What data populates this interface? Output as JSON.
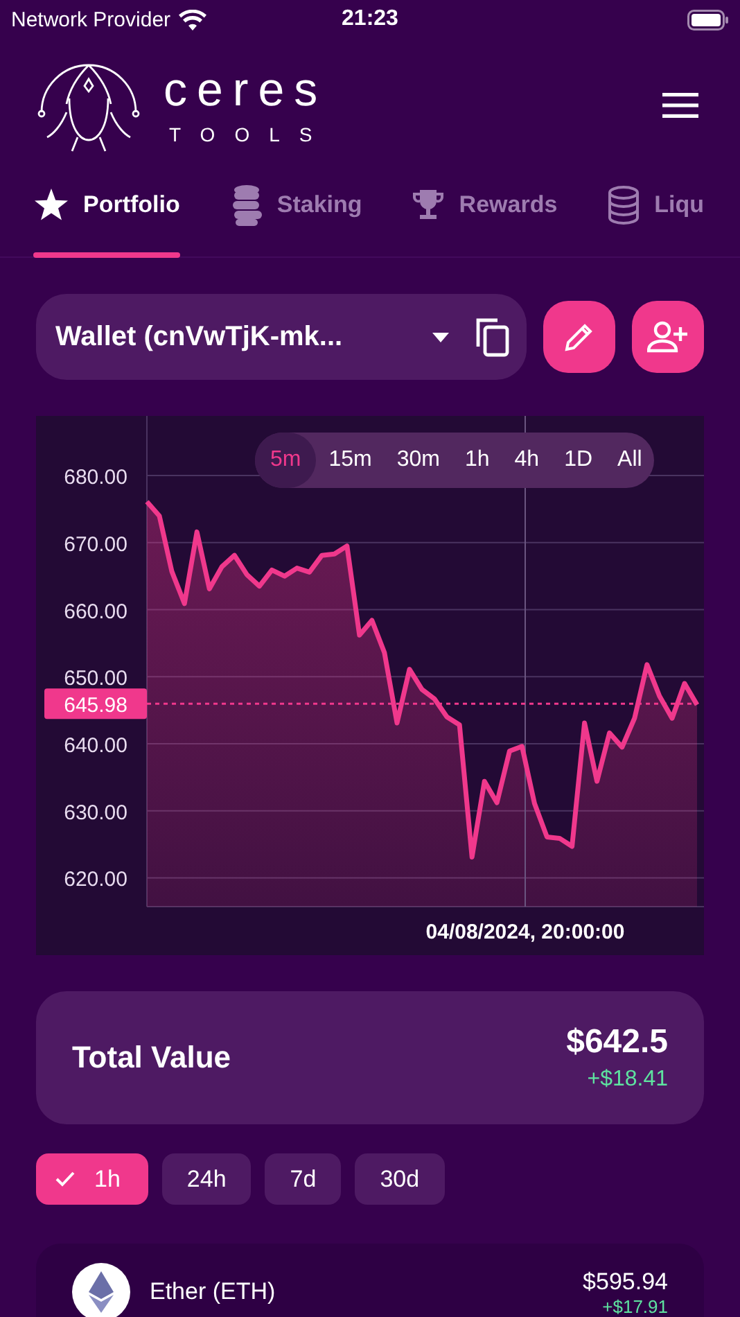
{
  "status_bar": {
    "carrier": "Network Provider",
    "time": "21:23"
  },
  "header": {
    "logo_title": "ceres",
    "logo_subtitle": "TOOLS"
  },
  "tabs": [
    {
      "label": "Portfolio",
      "kind": "star",
      "selected": true
    },
    {
      "label": "Staking",
      "kind": "coins",
      "selected": false
    },
    {
      "label": "Rewards",
      "kind": "trophy",
      "selected": false
    },
    {
      "label": "Liqu",
      "kind": "database",
      "selected": false
    }
  ],
  "wallet": {
    "value": "Wallet (cnVwTjK-mk..."
  },
  "chart": {
    "ranges": [
      {
        "label": "5m",
        "selected": true
      },
      {
        "label": "15m",
        "selected": false
      },
      {
        "label": "30m",
        "selected": false
      },
      {
        "label": "1h",
        "selected": false
      },
      {
        "label": "4h",
        "selected": false
      },
      {
        "label": "1D",
        "selected": false
      },
      {
        "label": "All",
        "selected": false
      }
    ],
    "chart_data": {
      "type": "area",
      "grid": true,
      "ylim": [
        615.7,
        688.9
      ],
      "yticks": [
        {
          "value": 620,
          "label": "620.00"
        },
        {
          "value": 630,
          "label": "630.00"
        },
        {
          "value": 640,
          "label": "640.00"
        },
        {
          "value": 650,
          "label": "650.00"
        },
        {
          "value": 660,
          "label": "660.00"
        },
        {
          "value": 670,
          "label": "670.00"
        },
        {
          "value": 680,
          "label": "680.00"
        }
      ],
      "series": [
        {
          "color": "#f0388c",
          "values": [
            676.1,
            674.0,
            665.7,
            660.9,
            671.6,
            663.1,
            666.4,
            668.1,
            665.2,
            663.5,
            665.9,
            665.0,
            666.2,
            665.6,
            668.1,
            668.3,
            669.5,
            656.2,
            658.4,
            653.6,
            643.1,
            651.1,
            648.1,
            646.7,
            644.0,
            642.8,
            623.1,
            634.4,
            631.2,
            638.9,
            639.6,
            631.1,
            626.1,
            625.9,
            624.7,
            643.1,
            634.4,
            641.6,
            639.5,
            643.8,
            651.8,
            647.1,
            643.8,
            649.0,
            645.8
          ]
        }
      ],
      "ref_lines": [
        {
          "axis": "y",
          "value": 645.98,
          "label": "645.98"
        }
      ],
      "annotations": [
        "04/08/2024, 20:00:00"
      ]
    }
  },
  "total": {
    "label": "Total Value",
    "value": "$642.5",
    "change": "+$18.41"
  },
  "periods": [
    {
      "label": "1h",
      "selected": true
    },
    {
      "label": "24h",
      "selected": false
    },
    {
      "label": "7d",
      "selected": false
    },
    {
      "label": "30d",
      "selected": false
    }
  ],
  "assets": [
    {
      "name": "Ether (ETH)",
      "value": "$595.94",
      "change": "+$17.91"
    }
  ]
}
